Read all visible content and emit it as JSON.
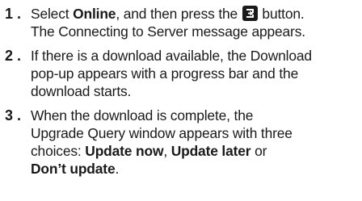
{
  "steps": [
    {
      "number": "1 .",
      "parts": {
        "p1": "Select ",
        "b1": "Online",
        "p2": ", and then press the ",
        "p3": " button.",
        "p4": "The Connecting to Server message appears."
      },
      "icon": "enter-button-icon"
    },
    {
      "number": "2 .",
      "parts": {
        "line1": "If there is a download available, the Download",
        "line2": "pop-up appears with a progress bar and the",
        "line3": "download starts."
      }
    },
    {
      "number": "3 .",
      "parts": {
        "line1": "When the download is complete, the",
        "line2a": "Upgrade Query window appears with three",
        "line3a": "choices: ",
        "b1": "Update now",
        "sep1": ", ",
        "b2": "Update later",
        "sep2": " or",
        "b3": "Don’t update",
        "end": "."
      }
    }
  ]
}
